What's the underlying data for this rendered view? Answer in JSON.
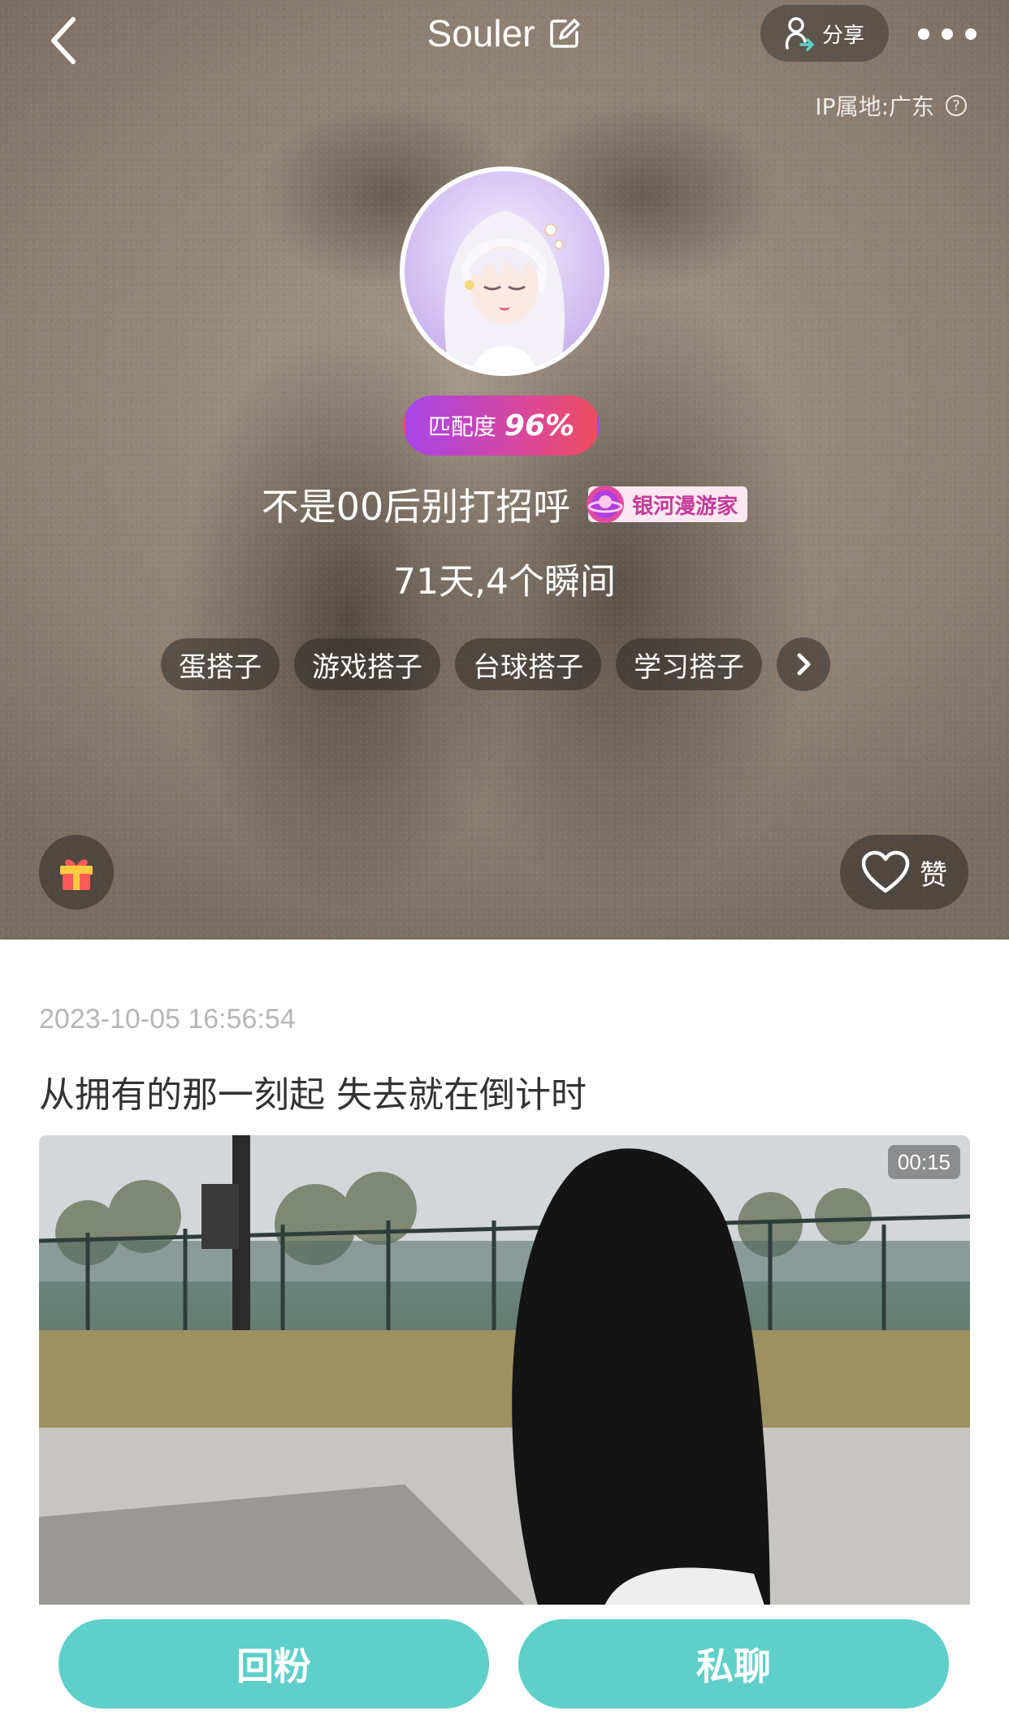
{
  "header": {
    "title": "Souler",
    "share_label": "分享",
    "ip_location": "IP属地:广东"
  },
  "profile": {
    "match_label": "匹配度",
    "match_value": "96%",
    "username": "不是00后别打招呼",
    "title_badge": "银河漫游家",
    "stats": "71天,4个瞬间",
    "tags": [
      "蛋搭子",
      "游戏搭子",
      "台球搭子",
      "学习搭子"
    ],
    "like_label": "赞"
  },
  "post": {
    "timestamp": "2023-10-05 16:56:54",
    "text": "从拥有的那一刻起 失去就在倒计时",
    "video_duration": "00:15"
  },
  "actions": {
    "follow_back": "回粉",
    "private_chat": "私聊"
  },
  "colors": {
    "accent": "#5ecfc9",
    "match_gradient_start": "#a846e8",
    "match_gradient_end": "#ee4d5f",
    "badge_text": "#c3399a"
  },
  "icons": [
    "back-arrow-icon",
    "edit-icon",
    "share-user-icon",
    "more-icon",
    "help-icon",
    "chevron-right-icon",
    "gift-icon",
    "heart-icon"
  ]
}
